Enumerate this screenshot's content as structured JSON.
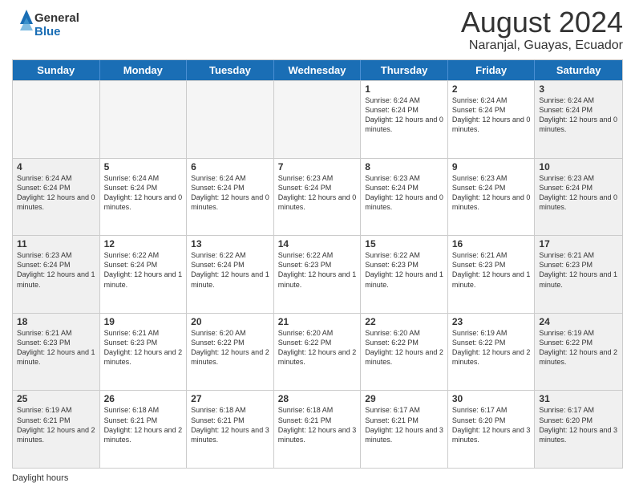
{
  "header": {
    "logo": {
      "general": "General",
      "blue": "Blue"
    },
    "title": "August 2024",
    "location": "Naranjal, Guayas, Ecuador"
  },
  "days_of_week": [
    "Sunday",
    "Monday",
    "Tuesday",
    "Wednesday",
    "Thursday",
    "Friday",
    "Saturday"
  ],
  "weeks": [
    [
      {
        "day": "",
        "empty": true
      },
      {
        "day": "",
        "empty": true
      },
      {
        "day": "",
        "empty": true
      },
      {
        "day": "",
        "empty": true
      },
      {
        "day": "1",
        "sunrise": "6:24 AM",
        "sunset": "6:24 PM",
        "daylight": "12 hours and 0 minutes."
      },
      {
        "day": "2",
        "sunrise": "6:24 AM",
        "sunset": "6:24 PM",
        "daylight": "12 hours and 0 minutes."
      },
      {
        "day": "3",
        "sunrise": "6:24 AM",
        "sunset": "6:24 PM",
        "daylight": "12 hours and 0 minutes."
      }
    ],
    [
      {
        "day": "4",
        "sunrise": "6:24 AM",
        "sunset": "6:24 PM",
        "daylight": "12 hours and 0 minutes."
      },
      {
        "day": "5",
        "sunrise": "6:24 AM",
        "sunset": "6:24 PM",
        "daylight": "12 hours and 0 minutes."
      },
      {
        "day": "6",
        "sunrise": "6:24 AM",
        "sunset": "6:24 PM",
        "daylight": "12 hours and 0 minutes."
      },
      {
        "day": "7",
        "sunrise": "6:23 AM",
        "sunset": "6:24 PM",
        "daylight": "12 hours and 0 minutes."
      },
      {
        "day": "8",
        "sunrise": "6:23 AM",
        "sunset": "6:24 PM",
        "daylight": "12 hours and 0 minutes."
      },
      {
        "day": "9",
        "sunrise": "6:23 AM",
        "sunset": "6:24 PM",
        "daylight": "12 hours and 0 minutes."
      },
      {
        "day": "10",
        "sunrise": "6:23 AM",
        "sunset": "6:24 PM",
        "daylight": "12 hours and 0 minutes."
      }
    ],
    [
      {
        "day": "11",
        "sunrise": "6:23 AM",
        "sunset": "6:24 PM",
        "daylight": "12 hours and 1 minute."
      },
      {
        "day": "12",
        "sunrise": "6:22 AM",
        "sunset": "6:24 PM",
        "daylight": "12 hours and 1 minute."
      },
      {
        "day": "13",
        "sunrise": "6:22 AM",
        "sunset": "6:24 PM",
        "daylight": "12 hours and 1 minute."
      },
      {
        "day": "14",
        "sunrise": "6:22 AM",
        "sunset": "6:23 PM",
        "daylight": "12 hours and 1 minute."
      },
      {
        "day": "15",
        "sunrise": "6:22 AM",
        "sunset": "6:23 PM",
        "daylight": "12 hours and 1 minute."
      },
      {
        "day": "16",
        "sunrise": "6:21 AM",
        "sunset": "6:23 PM",
        "daylight": "12 hours and 1 minute."
      },
      {
        "day": "17",
        "sunrise": "6:21 AM",
        "sunset": "6:23 PM",
        "daylight": "12 hours and 1 minute."
      }
    ],
    [
      {
        "day": "18",
        "sunrise": "6:21 AM",
        "sunset": "6:23 PM",
        "daylight": "12 hours and 1 minute."
      },
      {
        "day": "19",
        "sunrise": "6:21 AM",
        "sunset": "6:23 PM",
        "daylight": "12 hours and 2 minutes."
      },
      {
        "day": "20",
        "sunrise": "6:20 AM",
        "sunset": "6:22 PM",
        "daylight": "12 hours and 2 minutes."
      },
      {
        "day": "21",
        "sunrise": "6:20 AM",
        "sunset": "6:22 PM",
        "daylight": "12 hours and 2 minutes."
      },
      {
        "day": "22",
        "sunrise": "6:20 AM",
        "sunset": "6:22 PM",
        "daylight": "12 hours and 2 minutes."
      },
      {
        "day": "23",
        "sunrise": "6:19 AM",
        "sunset": "6:22 PM",
        "daylight": "12 hours and 2 minutes."
      },
      {
        "day": "24",
        "sunrise": "6:19 AM",
        "sunset": "6:22 PM",
        "daylight": "12 hours and 2 minutes."
      }
    ],
    [
      {
        "day": "25",
        "sunrise": "6:19 AM",
        "sunset": "6:21 PM",
        "daylight": "12 hours and 2 minutes."
      },
      {
        "day": "26",
        "sunrise": "6:18 AM",
        "sunset": "6:21 PM",
        "daylight": "12 hours and 2 minutes."
      },
      {
        "day": "27",
        "sunrise": "6:18 AM",
        "sunset": "6:21 PM",
        "daylight": "12 hours and 3 minutes."
      },
      {
        "day": "28",
        "sunrise": "6:18 AM",
        "sunset": "6:21 PM",
        "daylight": "12 hours and 3 minutes."
      },
      {
        "day": "29",
        "sunrise": "6:17 AM",
        "sunset": "6:21 PM",
        "daylight": "12 hours and 3 minutes."
      },
      {
        "day": "30",
        "sunrise": "6:17 AM",
        "sunset": "6:20 PM",
        "daylight": "12 hours and 3 minutes."
      },
      {
        "day": "31",
        "sunrise": "6:17 AM",
        "sunset": "6:20 PM",
        "daylight": "12 hours and 3 minutes."
      }
    ]
  ],
  "footer": {
    "daylight_hours_label": "Daylight hours"
  },
  "colors": {
    "header_bg": "#1a6eb5",
    "header_text": "#ffffff",
    "accent": "#1a6eb5"
  }
}
